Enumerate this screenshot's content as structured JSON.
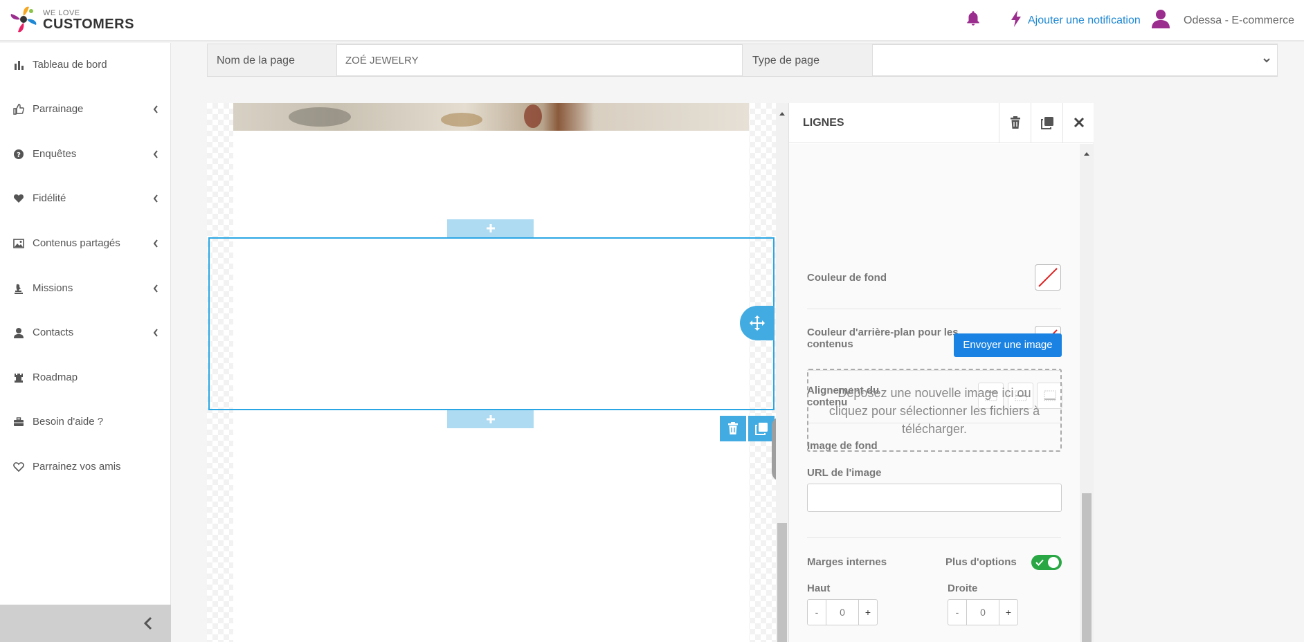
{
  "header": {
    "logo_small": "WE LOVE",
    "logo_big": "CUSTOMERS",
    "add_notification": "Ajouter une notification",
    "user_name": "Odessa - E-commerce"
  },
  "sidebar": {
    "items": [
      {
        "label": "Tableau de bord",
        "icon": "bar-chart-icon",
        "has_submenu": false
      },
      {
        "label": "Parrainage",
        "icon": "thumbs-up-icon",
        "has_submenu": true
      },
      {
        "label": "Enquêtes",
        "icon": "question-circle-icon",
        "has_submenu": true
      },
      {
        "label": "Fidélité",
        "icon": "heart-icon",
        "has_submenu": true
      },
      {
        "label": "Contenus partagés",
        "icon": "image-icon",
        "has_submenu": true
      },
      {
        "label": "Missions",
        "icon": "chess-icon",
        "has_submenu": true
      },
      {
        "label": "Contacts",
        "icon": "user-icon",
        "has_submenu": true
      },
      {
        "label": "Roadmap",
        "icon": "rook-icon",
        "has_submenu": false
      },
      {
        "label": "Besoin d'aide ?",
        "icon": "briefcase-icon",
        "has_submenu": false
      },
      {
        "label": "Parrainez vos amis",
        "icon": "heart-outline-icon",
        "has_submenu": false
      }
    ]
  },
  "page_form": {
    "name_label": "Nom de la page",
    "name_value": "ZOÉ JEWELRY",
    "type_label": "Type de page",
    "type_value": ""
  },
  "panel": {
    "title": "LIGNES",
    "bg_color_label": "Couleur de fond",
    "content_bg_label": "Couleur d'arrière-plan pour les contenus",
    "alignment_label": "Alignement du contenu",
    "bg_image_label": "Image de fond",
    "upload_button": "Envoyer une image",
    "dropzone_text": "Déposez une nouvelle image ici ou cliquez pour sélectionner les fichiers à télécharger.",
    "image_url_label": "URL de l'image",
    "image_url_value": "",
    "padding_label": "Marges internes",
    "more_options_label": "Plus d'options",
    "more_options_on": true,
    "top_label": "Haut",
    "top_value": "0",
    "right_label": "Droite",
    "right_value": "0",
    "minus": "-",
    "plus": "+"
  },
  "colors": {
    "accent": "#42ace2",
    "primary_button": "#1a82e2",
    "toggle_on": "#29a745",
    "bell": "#9b2d8e",
    "link": "#1e88d4"
  }
}
